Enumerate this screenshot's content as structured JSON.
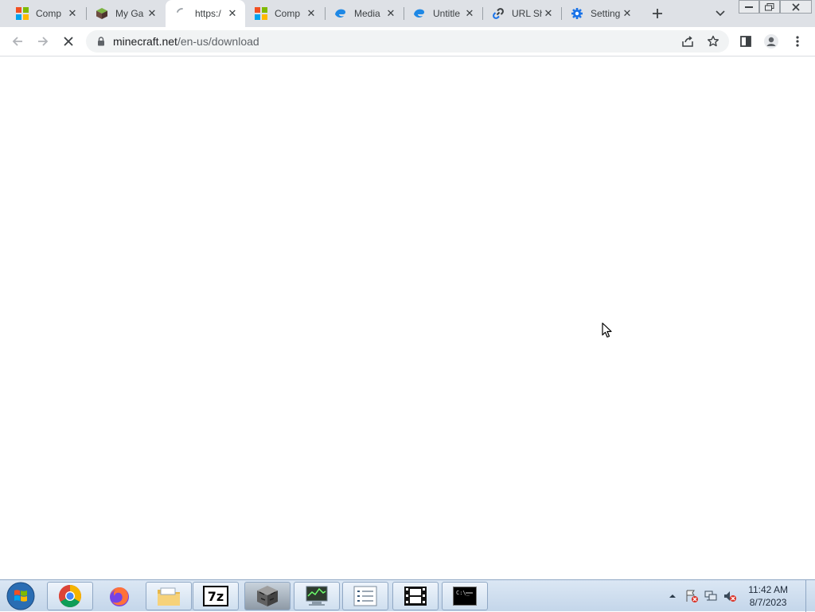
{
  "browser": {
    "tabs": [
      {
        "title": "Comp",
        "icon": "microsoft-icon",
        "active": false
      },
      {
        "title": "My Ga",
        "icon": "minecraft-block-icon",
        "active": false
      },
      {
        "title": "https:/",
        "icon": "loading-spinner-icon",
        "active": true
      },
      {
        "title": "Comp",
        "icon": "microsoft-icon",
        "active": false
      },
      {
        "title": "Media",
        "icon": "edge-icon",
        "active": false
      },
      {
        "title": "Untitle",
        "icon": "edge-icon",
        "active": false
      },
      {
        "title": "URL Sh",
        "icon": "link-icon",
        "active": false
      },
      {
        "title": "Setting",
        "icon": "gear-icon",
        "active": false
      }
    ],
    "address": {
      "host": "minecraft.net",
      "path": "/en-us/download"
    }
  },
  "taskbar": {
    "apps": [
      "chrome-icon",
      "firefox-icon",
      "file-explorer-icon",
      "7zip-icon",
      "minecraft-launcher-icon",
      "task-manager-icon",
      "notes-list-icon",
      "media-player-icon",
      "command-prompt-icon"
    ],
    "clock": {
      "time": "11:42 AM",
      "date": "8/7/2023"
    }
  },
  "colors": {
    "tabstrip_bg": "#dee1e6",
    "accent": "#1a73e8"
  }
}
